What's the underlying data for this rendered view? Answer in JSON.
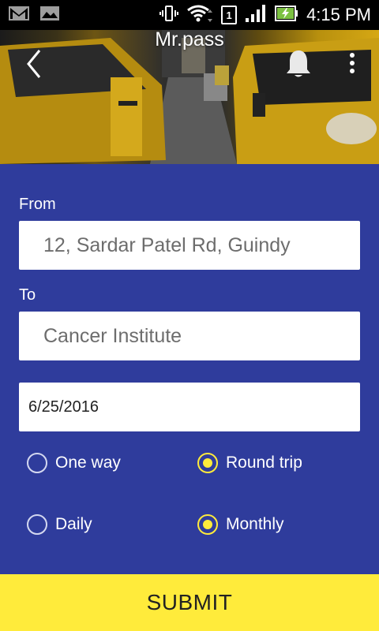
{
  "status_bar": {
    "time": "4:15 PM",
    "sim_slot": "1",
    "icons": [
      "gmail-icon",
      "photos-icon",
      "vibrate-icon",
      "wifi-icon",
      "signal-icon",
      "battery-charging-icon"
    ]
  },
  "header": {
    "title": "Mr.pass",
    "back_icon": "chevron-left-icon",
    "bell_icon": "bell-icon",
    "more_icon": "more-vert-icon"
  },
  "form": {
    "from_label": "From",
    "from_value": "12, Sardar Patel Rd, Guindy",
    "to_label": "To",
    "to_value": "Cancer Institute",
    "date_value": "6/25/2016",
    "trip_options": [
      {
        "label": "One way",
        "checked": false
      },
      {
        "label": "Round trip",
        "checked": true
      }
    ],
    "frequency_options": [
      {
        "label": "Daily",
        "checked": false
      },
      {
        "label": "Monthly",
        "checked": true
      }
    ],
    "submit_label": "SUBMIT"
  },
  "colors": {
    "primary_blue": "#2f3c9c",
    "accent_yellow": "#ffeb3b"
  }
}
